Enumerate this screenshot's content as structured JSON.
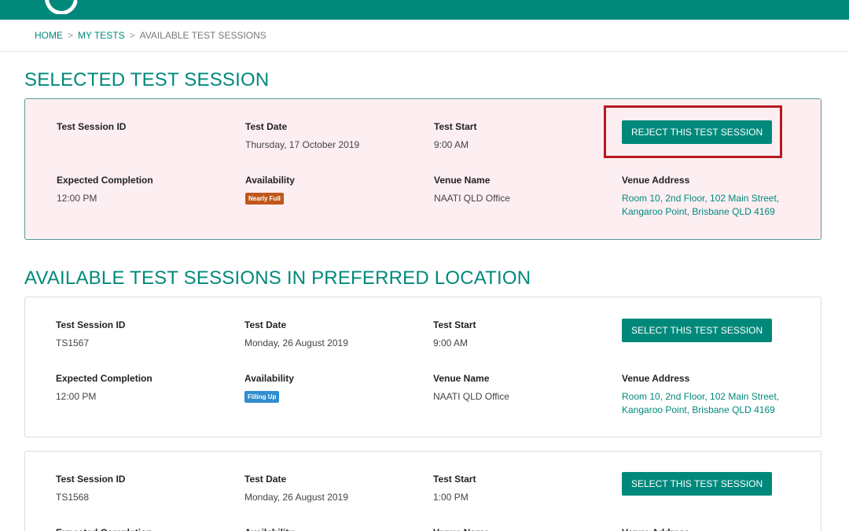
{
  "breadcrumb": {
    "home": "HOME",
    "my_tests": "MY TESTS",
    "current": "AVAILABLE TEST SESSIONS",
    "separator": ">"
  },
  "labels": {
    "session_id": "Test Session ID",
    "test_date": "Test Date",
    "test_start": "Test Start",
    "expected_completion": "Expected Completion",
    "availability": "Availability",
    "venue_name": "Venue Name",
    "venue_address": "Venue Address"
  },
  "selected_section": {
    "title": "SELECTED TEST SESSION",
    "session": {
      "id": "",
      "date": "Thursday, 17 October 2019",
      "start": "9:00 AM",
      "completion": "12:00 PM",
      "availability": "Nearly Full",
      "venue": "NAATI QLD Office",
      "address_line1": "Room 10, 2nd Floor, 102 Main Street,",
      "address_line2": "Kangaroo Point, Brisbane QLD 4169",
      "button": "REJECT THIS TEST SESSION"
    }
  },
  "available_section": {
    "title": "AVAILABLE TEST SESSIONS IN PREFERRED LOCATION",
    "sessions": [
      {
        "id": "TS1567",
        "date": "Monday, 26 August 2019",
        "start": "9:00 AM",
        "completion": "12:00 PM",
        "availability": "Filling Up",
        "venue": "NAATI QLD Office",
        "address_line1": "Room 10, 2nd Floor, 102 Main Street,",
        "address_line2": "Kangaroo Point, Brisbane QLD 4169",
        "button": "SELECT THIS TEST SESSION"
      },
      {
        "id": "TS1568",
        "date": "Monday, 26 August 2019",
        "start": "1:00 PM",
        "completion": "",
        "availability": "",
        "venue": "",
        "address_line1": "",
        "address_line2": "",
        "button": "SELECT THIS TEST SESSION"
      }
    ]
  },
  "colors": {
    "brand": "#00897b",
    "selected_card_bg": "#fdeef2",
    "nearly_full_badge": "#c0581b",
    "filling_up_badge": "#2f8ccf",
    "highlight_box": "#b7191c"
  }
}
